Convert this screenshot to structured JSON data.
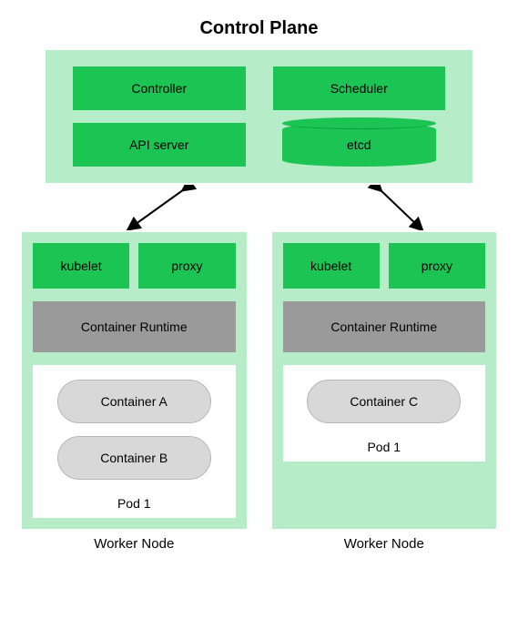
{
  "title": "Control Plane",
  "controlPlane": {
    "left": [
      "Controller",
      "API server"
    ],
    "right": [
      "Scheduler",
      "etcd"
    ]
  },
  "workers": [
    {
      "top": [
        "kubelet",
        "proxy"
      ],
      "runtime": "Container Runtime",
      "pod": {
        "containers": [
          "Container A",
          "Container B"
        ],
        "label": "Pod 1"
      },
      "label": "Worker Node"
    },
    {
      "top": [
        "kubelet",
        "proxy"
      ],
      "runtime": "Container Runtime",
      "pod": {
        "containers": [
          "Container C"
        ],
        "label": "Pod 1"
      },
      "label": "Worker Node"
    }
  ]
}
